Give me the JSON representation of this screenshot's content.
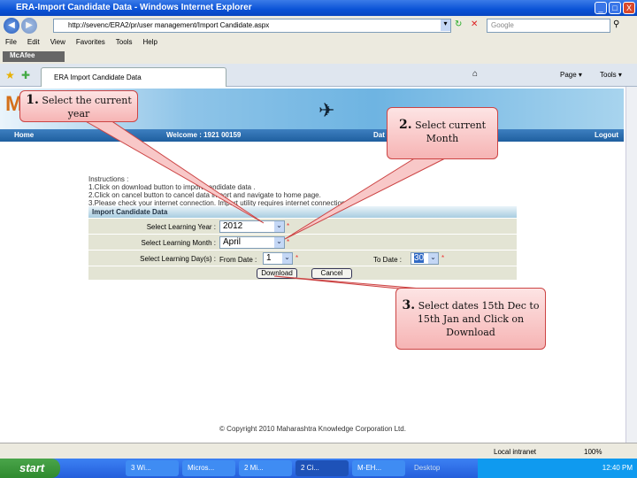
{
  "window": {
    "title": "ERA-Import Candidate Data - Windows Internet Explorer",
    "minimize": "_",
    "maximize": "□",
    "close": "X"
  },
  "browser": {
    "url": "http://sevenc/ERA2/pr/user management/Import Candidate.aspx",
    "search_placeholder": "Google",
    "menu": [
      "File",
      "Edit",
      "View",
      "Favorites",
      "Tools",
      "Help"
    ],
    "mcafee": "McAfee",
    "tab": "ERA Import Candidate Data",
    "tools": [
      "Page ▾",
      "Tools ▾"
    ]
  },
  "page": {
    "nav": {
      "home": "Home",
      "welcome": "Welcome : 1921 00159",
      "date": "Dat",
      "logout": "Logout"
    },
    "instructions": [
      "Instructions :",
      "1.Click on download button to import candidate data .",
      "2.Click on cancel button to cancel data import and navigate to home page.",
      "3.Please check your internet connection. Import utility requires internet connection."
    ],
    "form": {
      "header": "Import Candidate Data",
      "year_label": "Select Learning Year :",
      "year_value": "2012",
      "month_label": "Select Learning Month :",
      "month_value": "April",
      "day_label": "Select Learning Day(s) :",
      "from_label": "From Date :",
      "from_value": "1",
      "to_label": "To Date :",
      "to_value": "30",
      "download": "Download",
      "cancel": "Cancel"
    },
    "copyright": "© Copyright 2010 Maharashtra Knowledge Corporation Ltd."
  },
  "status": {
    "zone": "Local intranet",
    "zoom": "100%"
  },
  "taskbar": {
    "start": "start",
    "tasks": [
      "3 Wi...",
      "Micros...",
      "2 Mi...",
      "2 Ci...",
      "M-EH..."
    ],
    "desktop": "Desktop",
    "clock": "12:40 PM"
  },
  "callouts": {
    "c1_num": "1.",
    "c1_text": "Select the current year",
    "c2_num": "2.",
    "c2_text": "Select current Month",
    "c3_num": "3.",
    "c3_text": "Select dates 15th Dec to 15th Jan and Click on Download"
  }
}
